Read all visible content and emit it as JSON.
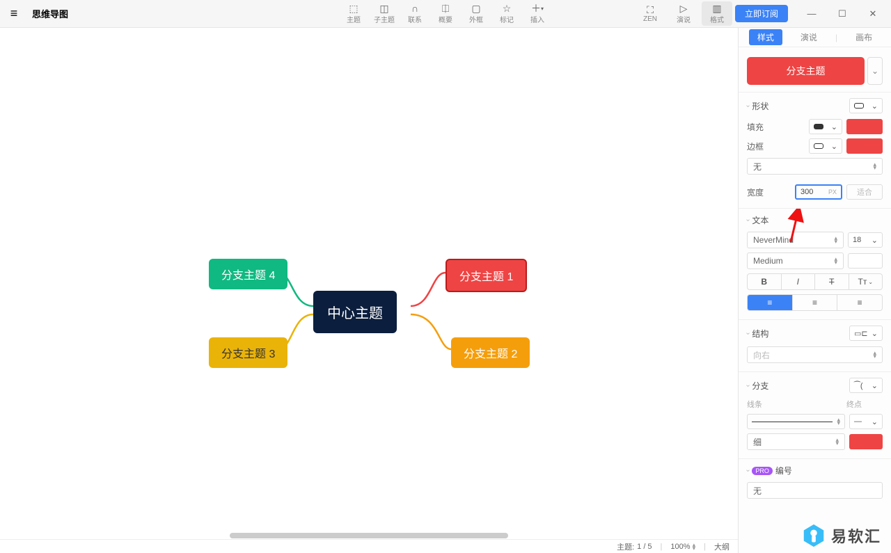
{
  "app": {
    "title": "思维导图"
  },
  "toolbar": {
    "items": [
      {
        "icon": "⬚",
        "label": "主题"
      },
      {
        "icon": "◫",
        "label": "子主题"
      },
      {
        "icon": "∩",
        "label": "联系"
      },
      {
        "icon": "⎅",
        "label": "概要"
      },
      {
        "icon": "▢",
        "label": "外框"
      },
      {
        "icon": "☆",
        "label": "标记"
      },
      {
        "icon": "＋",
        "label": "插入"
      }
    ],
    "right": [
      {
        "icon": "⛶",
        "label": "ZEN"
      },
      {
        "icon": "▷",
        "label": "演说"
      },
      {
        "icon": "▥",
        "label": "格式"
      }
    ],
    "subscribe": "立即订阅"
  },
  "mindmap": {
    "center": "中心主题",
    "branch1": "分支主题 1",
    "branch2": "分支主题 2",
    "branch3": "分支主题 3",
    "branch4": "分支主题 4"
  },
  "panel": {
    "tabs": {
      "style": "样式",
      "present": "演说",
      "canvas": "画布"
    },
    "topic_preview": "分支主题",
    "shape": {
      "title": "形状",
      "fill": "填充",
      "border": "边框",
      "none": "无",
      "width": "宽度",
      "width_value": "300",
      "width_unit": "PX",
      "fit": "适合"
    },
    "text": {
      "title": "文本",
      "font": "NeverMind",
      "size": "18",
      "weight": "Medium",
      "bold": "B",
      "italic": "I",
      "strike": "T",
      "case": "Tт"
    },
    "structure": {
      "title": "结构",
      "direction": "向右"
    },
    "branch": {
      "title": "分支",
      "line": "线条",
      "end": "终点",
      "thickness": "细"
    },
    "numbering": {
      "title": "编号",
      "pro": "PRO",
      "none": "无"
    }
  },
  "statusbar": {
    "topic": "主题:",
    "count": "1 / 5",
    "zoom": "100%",
    "outline": "大纲"
  },
  "watermark": "易软汇"
}
